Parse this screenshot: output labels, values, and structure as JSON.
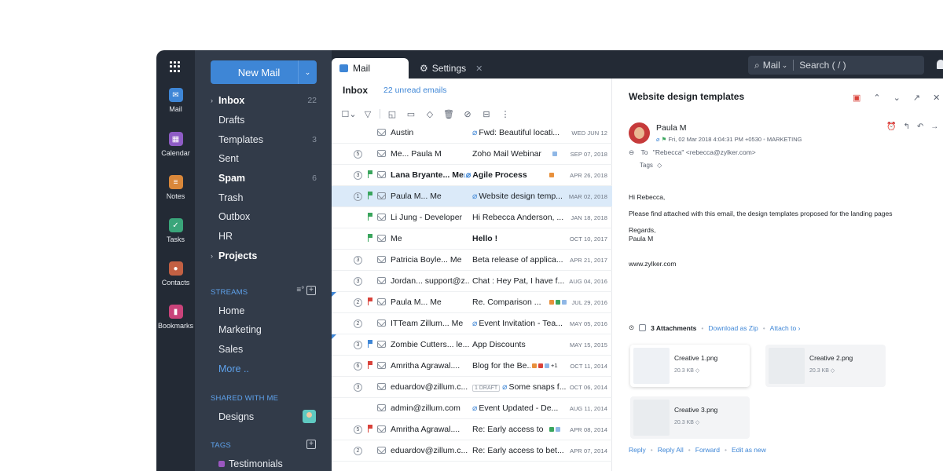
{
  "rail": {
    "items": [
      {
        "label": "Mail",
        "icon": "mail-icon",
        "color": "#3e86d6"
      },
      {
        "label": "Calendar",
        "icon": "calendar-icon",
        "color": "#8e5cc5"
      },
      {
        "label": "Notes",
        "icon": "notes-icon",
        "color": "#d9873a"
      },
      {
        "label": "Tasks",
        "icon": "tasks-icon",
        "color": "#3aa57a"
      },
      {
        "label": "Contacts",
        "icon": "contacts-icon",
        "color": "#c26043"
      },
      {
        "label": "Bookmarks",
        "icon": "bookmarks-icon",
        "color": "#c9437a"
      }
    ]
  },
  "folders": {
    "new_mail_label": "New Mail",
    "items": [
      {
        "name": "Inbox",
        "count": "22"
      },
      {
        "name": "Drafts",
        "count": ""
      },
      {
        "name": "Templates",
        "count": "3"
      },
      {
        "name": "Sent",
        "count": ""
      },
      {
        "name": "Spam",
        "count": "6"
      },
      {
        "name": "Trash",
        "count": ""
      },
      {
        "name": "Outbox",
        "count": ""
      },
      {
        "name": "HR",
        "count": ""
      },
      {
        "name": "Projects",
        "count": ""
      }
    ],
    "streams_heading": "STREAMS",
    "streams": [
      "Home",
      "Marketing",
      "Sales",
      "More .."
    ],
    "shared_heading": "SHARED WITH ME",
    "shared": [
      "Designs"
    ],
    "tags_heading": "TAGS",
    "tags": [
      "Testimonials"
    ]
  },
  "topbar": {
    "tab_mail": "Mail",
    "tab_settings": "Settings",
    "search_scope": "Mail",
    "search_placeholder": "Search ( / )"
  },
  "list": {
    "folder_title": "Inbox",
    "unread_label": "22 unread emails",
    "rows": [
      {
        "thread": "",
        "sender": "Austin",
        "subject": "Fwd: Beautiful locati...",
        "date": "WED JUN 12"
      },
      {
        "thread": "5",
        "sender": "Me... Paula M",
        "subject": "Zoho Mail Webinar",
        "date": "SEP 07, 2018"
      },
      {
        "thread": "3",
        "sender": "Lana Bryante... Me",
        "subject": "Agile Process",
        "date": "APR 26, 2018"
      },
      {
        "thread": "1",
        "sender": "Paula M... Me",
        "subject": "Website design temp...",
        "date": "MAR 02, 2018"
      },
      {
        "thread": "",
        "sender": "Li Jung - Developer",
        "subject": "Hi Rebecca Anderson, ...",
        "date": "JAN 18, 2018"
      },
      {
        "thread": "",
        "sender": "Me",
        "subject": "Hello !",
        "date": "OCT 10, 2017"
      },
      {
        "thread": "3",
        "sender": "Patricia Boyle... Me",
        "subject": "Beta release of applica...",
        "date": "APR 21, 2017"
      },
      {
        "thread": "3",
        "sender": "Jordan... support@z...",
        "subject": "Chat : Hey Pat, I have f...",
        "date": "AUG 04, 2016"
      },
      {
        "thread": "2",
        "sender": "Paula M... Me",
        "subject": "Re. Comparison ...",
        "date": "JUL 29, 2016"
      },
      {
        "thread": "2",
        "sender": "ITTeam Zillum... Me",
        "subject": "Event Invitation - Tea...",
        "date": "MAY 05, 2016"
      },
      {
        "thread": "3",
        "sender": "Zombie Cutters... le...",
        "subject": "App Discounts",
        "date": "MAY 15, 2015"
      },
      {
        "thread": "6",
        "sender": "Amritha Agrawal....",
        "subject": "Blog for the Be...",
        "date": "OCT 11, 2014"
      },
      {
        "thread": "3",
        "sender": "eduardov@zillum.c...",
        "subject": "Some snaps f...",
        "date": "OCT 06, 2014"
      },
      {
        "thread": "",
        "sender": "admin@zillum.com",
        "subject": "Event Updated - De...",
        "date": "AUG 11, 2014"
      },
      {
        "thread": "5",
        "sender": "Amritha Agrawal....",
        "subject": "Re: Early access to ...",
        "date": "APR 08, 2014"
      },
      {
        "thread": "2",
        "sender": "eduardov@zillum.c...",
        "subject": "Re: Early access to bet...",
        "date": "APR 07, 2014"
      }
    ],
    "agile_count": "1",
    "plus_one": "+1",
    "draft_badge": "1 DRAFT"
  },
  "reader": {
    "title": "Website design templates",
    "from_name": "Paula M",
    "sent_time": "Fri, 02 Mar 2018 4:04:31 PM +0530",
    "label": "MARKETING",
    "to_prefix": "To",
    "to": "\"Rebecca\" <rebecca@zylker.com>",
    "tags_label": "Tags",
    "body": {
      "greeting": "Hi Rebecca,",
      "line1": "Please find attached with this email, the design templates proposed for the landing pages",
      "regards": "Regards,",
      "signature": "Paula M",
      "website": "www.zylker.com"
    },
    "attachments_label": "3 Attachments",
    "download_zip": "Download as Zip",
    "attach_to": "Attach to ›",
    "files": [
      {
        "name": "Creative 1.png",
        "size": "20.3 KB"
      },
      {
        "name": "Creative 2.png",
        "size": "20.3 KB"
      },
      {
        "name": "Creative 3.png",
        "size": "20.3 KB"
      }
    ],
    "actions": [
      "Reply",
      "Reply All",
      "Forward",
      "Edit as new"
    ]
  },
  "colors": {
    "accent": "#3e86d6",
    "rail_bg": "#232a35",
    "folder_bg": "#323b49",
    "selected_row": "#dbeaf9"
  }
}
